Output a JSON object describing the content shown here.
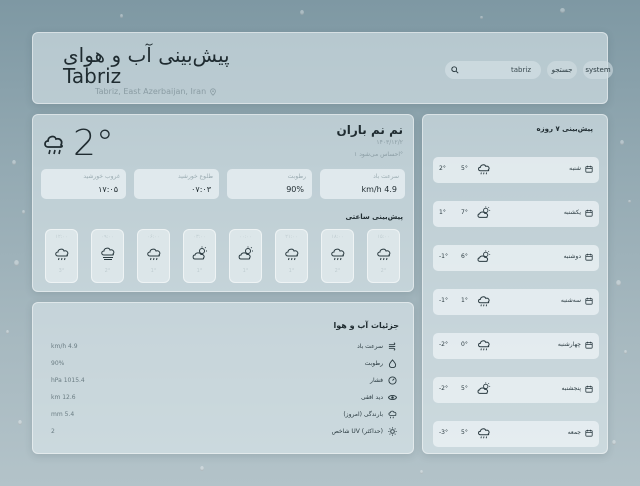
{
  "header": {
    "title": "پیش‌بینی آب و هوای",
    "city": "Tabriz",
    "location": "Tabriz, East Azerbaijan, Iran",
    "search_value": "tabriz",
    "search_button": "جستجو",
    "theme_button": "system"
  },
  "current": {
    "temp": "2°",
    "condition": "نم نم باران",
    "date": "۱۴۰۳/۱۲/۲",
    "feels_like": "احساس می‌شود ۱°",
    "stats": [
      {
        "label": "سرعت باد",
        "value": "km/h 4.9"
      },
      {
        "label": "رطوبت",
        "value": "90%"
      },
      {
        "label": "طلوع خورشید",
        "value": "۰۷:۰۳"
      },
      {
        "label": "غروب خورشید",
        "value": "۱۷:۰۵"
      }
    ]
  },
  "hourly": {
    "title": "پیش‌بینی ساعتی",
    "items": [
      {
        "icon": "rain-cloud-icon",
        "time": "۱۵:۰۰",
        "temp": "2°"
      },
      {
        "icon": "rain-cloud-icon",
        "time": "۱۸:۰۰",
        "temp": "2°"
      },
      {
        "icon": "rain-cloud-icon",
        "time": "۲۱:۰۰",
        "temp": "1°"
      },
      {
        "icon": "partly-cloudy-icon",
        "time": "۰۰:۰۰",
        "temp": "1°"
      },
      {
        "icon": "partly-cloudy-icon",
        "time": "۰۳:۰۰",
        "temp": "1°"
      },
      {
        "icon": "rain-cloud-icon",
        "time": "۰۶:۰۰",
        "temp": "1°"
      },
      {
        "icon": "fog-icon",
        "time": "۰۹:۰۰",
        "temp": "2°"
      },
      {
        "icon": "rain-cloud-icon",
        "time": "۱۲:۰۰",
        "temp": "3°"
      }
    ]
  },
  "details": {
    "title": "جزئیات آب و هوا",
    "rows": [
      {
        "label": "سرعت باد",
        "value": "km/h 4.9",
        "icon": "wind-icon"
      },
      {
        "label": "رطوبت",
        "value": "90%",
        "icon": "droplet-icon"
      },
      {
        "label": "فشار",
        "value": "hPa 1015.4",
        "icon": "gauge-icon"
      },
      {
        "label": "دید افقی",
        "value": "km 12.6",
        "icon": "eye-icon"
      },
      {
        "label": "بارندگی (امروز)",
        "value": "mm 5.4",
        "icon": "rain-icon"
      },
      {
        "label": "شاخص UV (حداکثر)",
        "value": "2",
        "icon": "sun-icon"
      }
    ]
  },
  "forecast": {
    "title": "پیش‌بینی ۷ روزه",
    "days": [
      {
        "day": "شنبه",
        "hi": "5°",
        "lo": "2°",
        "icon": "rain-cloud-icon"
      },
      {
        "day": "یکشنبه",
        "hi": "7°",
        "lo": "1°",
        "icon": "partly-cloudy-icon"
      },
      {
        "day": "دوشنبه",
        "hi": "6°",
        "lo": "-1°",
        "icon": "partly-cloudy-icon"
      },
      {
        "day": "سه‌شنبه",
        "hi": "1°",
        "lo": "-1°",
        "icon": "rain-cloud-icon"
      },
      {
        "day": "چهارشنبه",
        "hi": "0°",
        "lo": "-2°",
        "icon": "rain-cloud-icon"
      },
      {
        "day": "پنجشنبه",
        "hi": "5°",
        "lo": "-2°",
        "icon": "partly-cloudy-icon"
      },
      {
        "day": "جمعه",
        "hi": "5°",
        "lo": "-3°",
        "icon": "rain-cloud-icon"
      }
    ]
  }
}
